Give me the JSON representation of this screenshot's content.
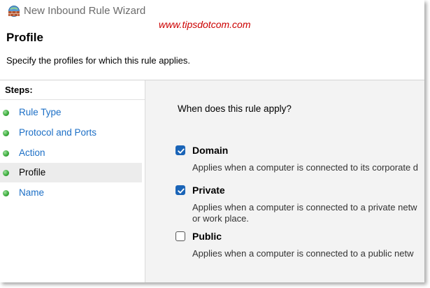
{
  "window": {
    "title": "New Inbound Rule Wizard"
  },
  "watermark": "www.tipsdotcom.com",
  "page": {
    "title": "Profile",
    "description": "Specify the profiles for which this rule applies."
  },
  "steps": {
    "header": "Steps:",
    "items": [
      {
        "label": "Rule Type",
        "current": false
      },
      {
        "label": "Protocol and Ports",
        "current": false
      },
      {
        "label": "Action",
        "current": false
      },
      {
        "label": "Profile",
        "current": true
      },
      {
        "label": "Name",
        "current": false
      }
    ]
  },
  "content": {
    "question": "When does this rule apply?",
    "options": [
      {
        "name": "Domain",
        "checked": true,
        "description_lines": [
          "Applies when a computer is connected to its corporate d"
        ]
      },
      {
        "name": "Private",
        "checked": true,
        "description_lines": [
          "Applies when a computer is connected to a private netw",
          "or work place."
        ]
      },
      {
        "name": "Public",
        "checked": false,
        "description_lines": [
          "Applies when a computer is connected to a public netw"
        ]
      }
    ]
  },
  "colors": {
    "link": "#1c6fc6",
    "checkbox_checked": "#1a64b7",
    "watermark": "#cc0000",
    "step_dot": "#3fae3f"
  },
  "icons": {
    "app": "firewall-wall-icon",
    "step": "green-dot-icon",
    "check": "checkmark-icon"
  }
}
